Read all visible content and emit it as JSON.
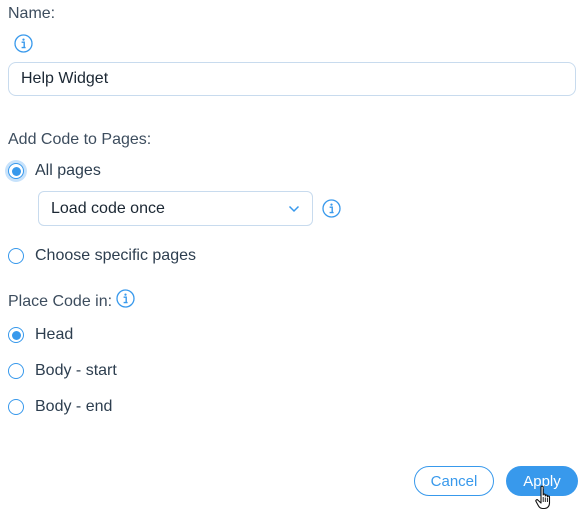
{
  "name_section": {
    "label": "Name:",
    "info_icon": "info-icon",
    "input_value": "Help Widget"
  },
  "pages_section": {
    "label": "Add Code to Pages:",
    "options": [
      {
        "label": "All pages",
        "selected": true
      },
      {
        "label": "Choose specific pages",
        "selected": false
      }
    ],
    "load_select": {
      "value": "Load code once",
      "icon": "chevron-down-icon"
    }
  },
  "place_section": {
    "label": "Place Code in:",
    "options": [
      {
        "label": "Head",
        "selected": true
      },
      {
        "label": "Body - start",
        "selected": false
      },
      {
        "label": "Body - end",
        "selected": false
      }
    ]
  },
  "footer": {
    "cancel_label": "Cancel",
    "apply_label": "Apply"
  },
  "colors": {
    "accent": "#3899ec",
    "border": "#c8dbee",
    "text": "#2d3e4f"
  }
}
